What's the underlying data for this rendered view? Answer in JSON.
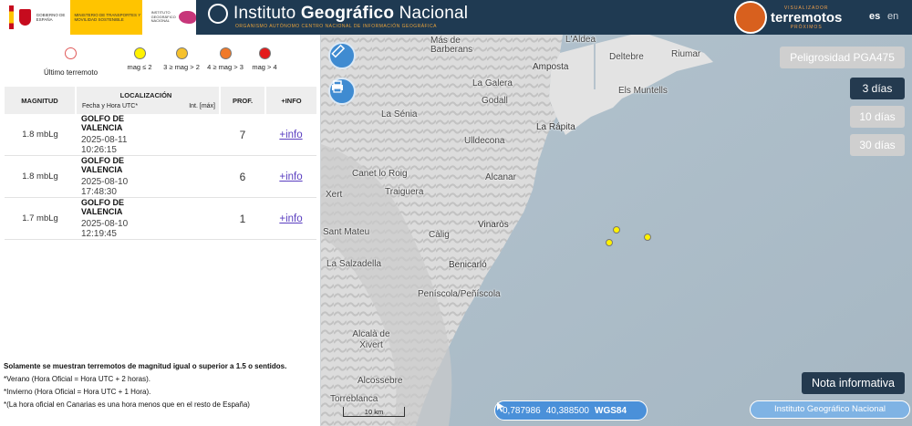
{
  "header": {
    "gov_text": "GOBIERNO DE ESPAÑA",
    "ministry_text": "MINISTERIO DE TRANSPORTES Y MOVILIDAD SOSTENIBLE",
    "ign_small_text": "INSTITUTO GEOGRÁFICO NACIONAL",
    "title_prefix": "Instituto ",
    "title_bold": "Geográfico",
    "title_suffix": " Nacional",
    "subtitle": "ORGANISMO AUTÓNOMO  CENTRO NACIONAL DE INFORMACIÓN GEOGRÁFICA",
    "app_small_top": "VISUALIZADOR",
    "app_name": "terremotos",
    "app_small_bottom": "PRÓXIMOS",
    "lang_es": "es",
    "lang_en": "en"
  },
  "legend": {
    "last": "Último terremoto",
    "items": [
      {
        "label": "mag ≤ 2",
        "color": "#fff200"
      },
      {
        "label": "3 ≥ mag > 2",
        "color": "#f6c12c"
      },
      {
        "label": "4 ≥ mag > 3",
        "color": "#f07a2a"
      },
      {
        "label": "mag > 4",
        "color": "#e31c1c"
      }
    ]
  },
  "table": {
    "headers": {
      "magnitude": "MAGNITUD",
      "location": "LOCALIZACIÓN",
      "datetime": "Fecha y Hora UTC*",
      "intensity": "Int. [máx]",
      "depth": "PROF.",
      "info": "+INFO"
    },
    "rows": [
      {
        "magnitude": "1.8 mbLg",
        "place": "GOLFO DE VALENCIA",
        "datetime": "2025-08-11 10:26:15",
        "depth": "7",
        "info": "+info"
      },
      {
        "magnitude": "1.8 mbLg",
        "place": "GOLFO DE VALENCIA",
        "datetime": "2025-08-10 17:48:30",
        "depth": "6",
        "info": "+info"
      },
      {
        "magnitude": "1.7 mbLg",
        "place": "GOLFO DE VALENCIA",
        "datetime": "2025-08-10 12:19:45",
        "depth": "1",
        "info": "+info"
      }
    ]
  },
  "notes": {
    "line1": "Solamente se muestran terremotos de magnitud igual o superior a 1.5 o sentidos.",
    "line2": "*Verano (Hora Oficial = Hora UTC + 2 horas).",
    "line3": "*Invierno (Hora Oficial = Hora UTC + 1 Hora).",
    "line4": "*(La hora oficial en Canarias es una hora menos que en el resto de España)"
  },
  "map": {
    "labels": [
      {
        "text": "L'Aldea",
        "cls": ""
      },
      {
        "text": "Deltebre",
        "cls": ""
      },
      {
        "text": "Riumar",
        "cls": ""
      },
      {
        "text": "Más de Barberans",
        "cls": ""
      },
      {
        "text": "Amposta",
        "cls": "city"
      },
      {
        "text": "La Galera",
        "cls": ""
      },
      {
        "text": "Els Muntells",
        "cls": ""
      },
      {
        "text": "Godall",
        "cls": ""
      },
      {
        "text": "La Sénia",
        "cls": ""
      },
      {
        "text": "La Rápita",
        "cls": "city"
      },
      {
        "text": "Ulldecona",
        "cls": ""
      },
      {
        "text": "Canet lo Roig",
        "cls": ""
      },
      {
        "text": "Alcanar",
        "cls": ""
      },
      {
        "text": "Xert",
        "cls": ""
      },
      {
        "text": "Traiguera",
        "cls": ""
      },
      {
        "text": "Vinaròs",
        "cls": "city"
      },
      {
        "text": "Sant Mateu",
        "cls": ""
      },
      {
        "text": "Càlig",
        "cls": ""
      },
      {
        "text": "La Salzadella",
        "cls": ""
      },
      {
        "text": "Benicarló",
        "cls": "city"
      },
      {
        "text": "Peníscola/Peñíscola",
        "cls": ""
      },
      {
        "text": "Alcalà de Xivert",
        "cls": ""
      },
      {
        "text": "Alcossebre",
        "cls": ""
      },
      {
        "text": "Torreblanca",
        "cls": ""
      }
    ],
    "peligrosidad": "Peligrosidad PGA475",
    "days": [
      "3 días",
      "10 días",
      "30 días"
    ],
    "active_days": "3 días",
    "nota": "Nota informativa",
    "coords": {
      "x": "0,787986",
      "y": "40,388500",
      "crs": "WGS84"
    },
    "ign_button": "Instituto Geográfico Nacional",
    "scale_label": "10 km"
  }
}
